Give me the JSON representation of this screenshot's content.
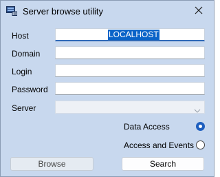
{
  "window": {
    "title": "Server browse utility",
    "app_icon": "server-browse-icon",
    "close_icon": "close-icon"
  },
  "form": {
    "host": {
      "label": "Host",
      "value": "LOCALHOST"
    },
    "domain": {
      "label": "Domain",
      "value": ""
    },
    "login": {
      "label": "Login",
      "value": ""
    },
    "password": {
      "label": "Password",
      "value": ""
    },
    "server": {
      "label": "Server",
      "value": "",
      "icon": "chevron-down-icon"
    }
  },
  "options": {
    "data_access": {
      "label": "Data Access",
      "checked": true
    },
    "access_and_events": {
      "label": "Access and Events",
      "checked": false
    }
  },
  "buttons": {
    "browse": "Browse",
    "search": "Search"
  },
  "colors": {
    "background": "#c8d8ee",
    "accent": "#1e5fbf",
    "selection": "#0a64c8"
  }
}
